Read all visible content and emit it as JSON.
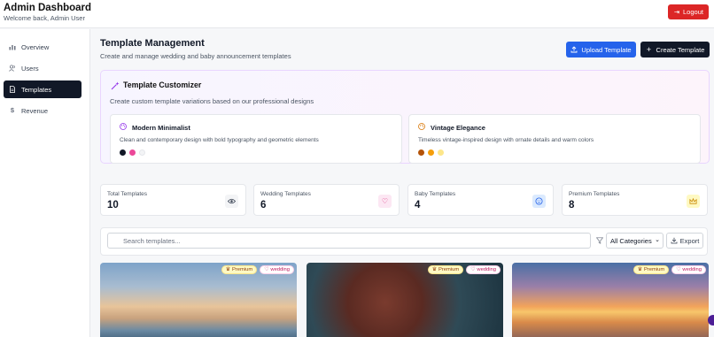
{
  "header": {
    "title": "Admin Dashboard",
    "subtitle": "Welcome back, Admin User",
    "logout_label": "Logout"
  },
  "sidebar": {
    "items": [
      {
        "label": "Overview",
        "icon": "bar-chart-icon",
        "active": false
      },
      {
        "label": "Users",
        "icon": "users-icon",
        "active": false
      },
      {
        "label": "Templates",
        "icon": "file-icon",
        "active": true
      },
      {
        "label": "Revenue",
        "icon": "dollar-icon",
        "active": false
      }
    ]
  },
  "page": {
    "title": "Template Management",
    "subtitle": "Create and manage wedding and baby announcement templates",
    "upload_label": "Upload Template",
    "create_label": "Create Template"
  },
  "customizer": {
    "title": "Template Customizer",
    "subtitle": "Create custom template variations based on our professional designs",
    "cards": [
      {
        "name": "Modern Minimalist",
        "desc": "Clean and contemporary design with bold typography and geometric elements",
        "icon": "palette-icon",
        "colors": [
          "#111827",
          "#ec4899",
          "#f3f4f6"
        ]
      },
      {
        "name": "Vintage Elegance",
        "desc": "Timeless vintage-inspired design with ornate details and warm colors",
        "icon": "palette-icon",
        "colors": [
          "#b45309",
          "#f59e0b",
          "#fde68a"
        ]
      }
    ]
  },
  "stats": [
    {
      "label": "Total Templates",
      "value": "10",
      "icon": "eye-icon",
      "icon_bg": "#f3f4f6",
      "icon_color": "#374151"
    },
    {
      "label": "Wedding Templates",
      "value": "6",
      "icon": "heart-icon",
      "icon_bg": "#fce7f3",
      "icon_color": "#db2777"
    },
    {
      "label": "Baby Templates",
      "value": "4",
      "icon": "baby-icon",
      "icon_bg": "#dbeafe",
      "icon_color": "#2563eb"
    },
    {
      "label": "Premium Templates",
      "value": "8",
      "icon": "crown-icon",
      "icon_bg": "#fef9c3",
      "icon_color": "#ca8a04"
    }
  ],
  "filters": {
    "search_placeholder": "Search templates...",
    "category": "All Categories",
    "export_label": "Export"
  },
  "templates": [
    {
      "premium": "Premium",
      "category": "wedding"
    },
    {
      "premium": "Premium",
      "category": "wedding"
    },
    {
      "premium": "Premium",
      "category": "wedding"
    }
  ]
}
